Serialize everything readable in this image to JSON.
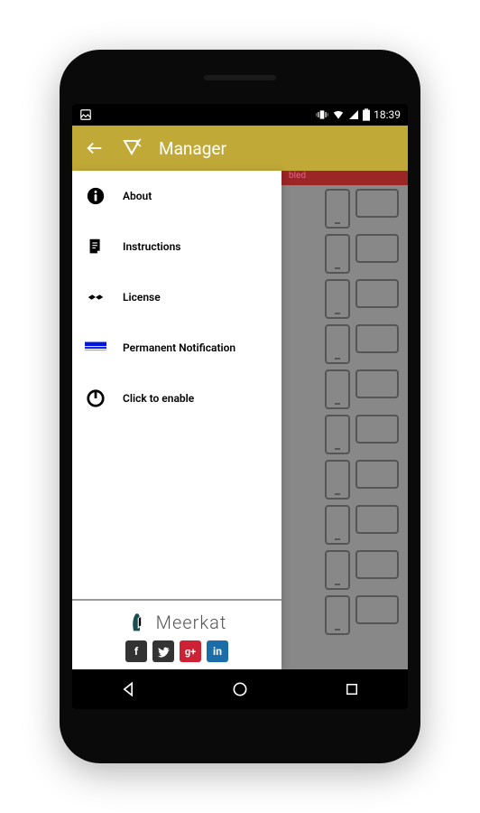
{
  "statusBar": {
    "time": "18:39"
  },
  "appBar": {
    "title": "Manager"
  },
  "bgStrip": {
    "text": "bled"
  },
  "drawer": {
    "items": [
      {
        "label": "About"
      },
      {
        "label": "Instructions"
      },
      {
        "label": "License"
      },
      {
        "label": "Permanent Notification"
      },
      {
        "label": "Click to enable"
      }
    ],
    "footer": {
      "brand": "Meerkat"
    }
  }
}
